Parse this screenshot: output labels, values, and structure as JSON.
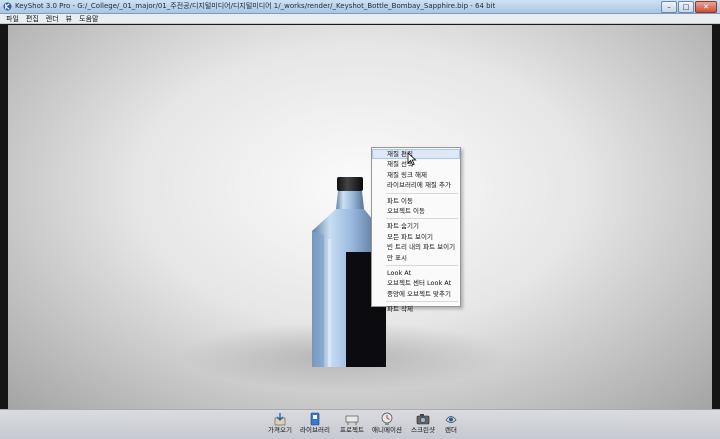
{
  "window": {
    "title": "KeyShot 3.0 Pro  - G:/_College/_01_major/01_주전공/디지털미디어/디지털미디어 1/_works/render/_Keyshot_Bottle_Bombay_Sapphire.bip  - 64 bit",
    "minimize": "–",
    "maximize": "□",
    "close": "✕"
  },
  "menu": [
    "파일",
    "편집",
    "렌더",
    "뷰",
    "도움말"
  ],
  "context_menu": {
    "groups": [
      [
        "재질 편집",
        "재질 선택",
        "재질 링크 해제",
        "라이브러리에 재질 추가"
      ],
      [
        "파트 이동",
        "오브젝트 이동"
      ],
      [
        "파트 숨기기",
        "모든 파트 보이기",
        "빈 트리 내의 파트 보이기",
        "만 표시"
      ],
      [
        "Look At",
        "오브젝트 센터 Look At",
        "중앙에 오브젝트 맞추기"
      ],
      [
        "파트 삭제"
      ]
    ],
    "highlighted": "재질 편집"
  },
  "toolbar": {
    "items": [
      {
        "label": "가져오기",
        "icon": "import-icon"
      },
      {
        "label": "라이브러리",
        "icon": "library-icon"
      },
      {
        "label": "프로젝트",
        "icon": "project-icon"
      },
      {
        "label": "애니메이션",
        "icon": "animation-icon"
      },
      {
        "label": "스크린샷",
        "icon": "screenshot-icon"
      },
      {
        "label": "렌더",
        "icon": "render-icon"
      }
    ]
  },
  "colors": {
    "accent": "#3a6fd0",
    "highlight": "#dde9f8",
    "liquid": "#9fc0e6"
  }
}
